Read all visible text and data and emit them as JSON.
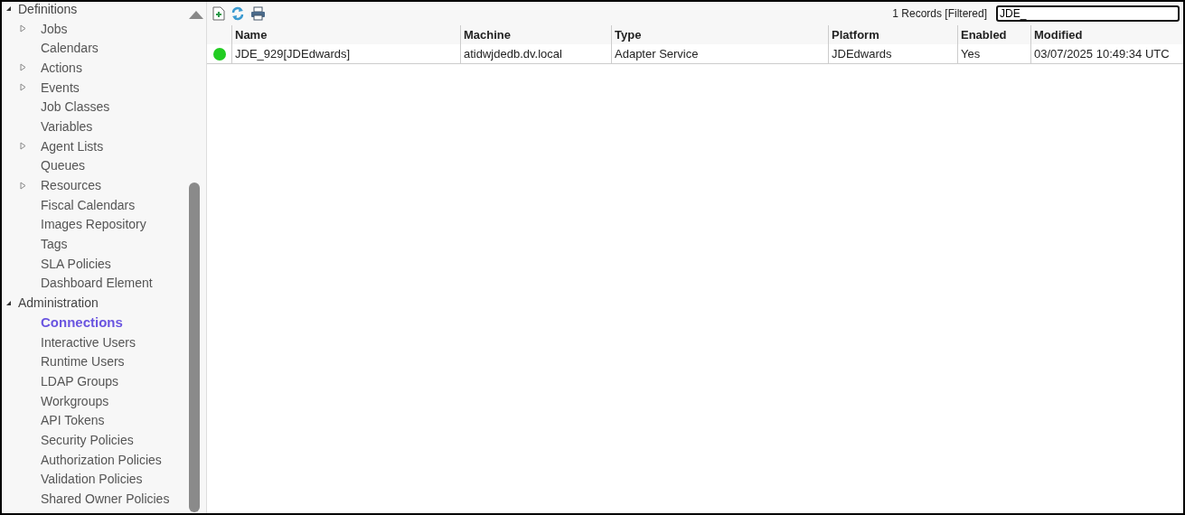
{
  "tree": [
    {
      "label": "Definitions",
      "expanded": true,
      "selected": false,
      "children": [
        {
          "label": "Jobs",
          "expanded": false,
          "selected": false
        },
        {
          "label": "Calendars",
          "selected": false
        },
        {
          "label": "Actions",
          "expanded": false,
          "selected": false
        },
        {
          "label": "Events",
          "expanded": false,
          "selected": false
        },
        {
          "label": "Job Classes",
          "selected": false
        },
        {
          "label": "Variables",
          "selected": false
        },
        {
          "label": "Agent Lists",
          "expanded": false,
          "selected": false
        },
        {
          "label": "Queues",
          "selected": false
        },
        {
          "label": "Resources",
          "expanded": false,
          "selected": false
        },
        {
          "label": "Fiscal Calendars",
          "selected": false
        },
        {
          "label": "Images Repository",
          "selected": false
        },
        {
          "label": "Tags",
          "selected": false
        },
        {
          "label": "SLA Policies",
          "selected": false
        },
        {
          "label": "Dashboard Element",
          "selected": false
        }
      ]
    },
    {
      "label": "Administration",
      "expanded": true,
      "selected": false,
      "children": [
        {
          "label": "Connections",
          "selected": true
        },
        {
          "label": "Interactive Users",
          "selected": false
        },
        {
          "label": "Runtime Users",
          "selected": false
        },
        {
          "label": "LDAP Groups",
          "selected": false
        },
        {
          "label": "Workgroups",
          "selected": false
        },
        {
          "label": "API Tokens",
          "selected": false
        },
        {
          "label": "Security Policies",
          "selected": false
        },
        {
          "label": "Authorization Policies",
          "selected": false
        },
        {
          "label": "Validation Policies",
          "selected": false
        },
        {
          "label": "Shared Owner Policies",
          "selected": false
        }
      ]
    }
  ],
  "toolbar": {
    "records": "1 Records [Filtered]",
    "filter": {
      "value": "JDE_"
    }
  },
  "table": {
    "columns": [
      "Name",
      "Machine",
      "Type",
      "Platform",
      "Enabled",
      "Modified"
    ],
    "rows": [
      {
        "color": "#22cc22",
        "cells": [
          "JDE_929[JDEdwards]",
          "atidwjdedb.dv.local",
          "Adapter Service",
          "JDEdwards",
          "Yes",
          "03/07/2025 10:49:34 UTC"
        ]
      }
    ]
  }
}
